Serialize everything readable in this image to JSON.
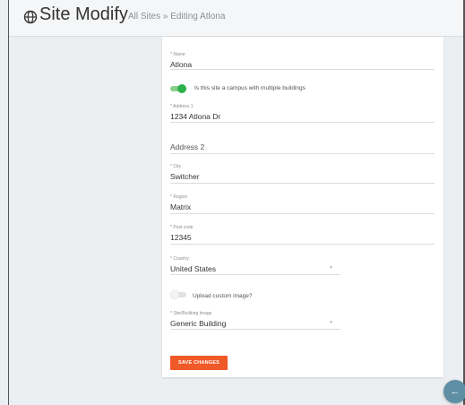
{
  "header": {
    "icon": "globe-icon",
    "title": "Site Modify",
    "breadcrumb": {
      "link": "All Sites",
      "separator": "»",
      "current": "Editing Atlona"
    }
  },
  "form": {
    "name": {
      "label": "* Name",
      "value": "Atlona"
    },
    "campus_toggle": {
      "label": "Is this site a campus with multiple buildings",
      "on": true
    },
    "address1": {
      "label": "* Address 1",
      "value": "1234 Atlona Dr"
    },
    "address2": {
      "placeholder": "Address 2"
    },
    "city": {
      "label": "* City",
      "value": "Switcher"
    },
    "region": {
      "label": "* Region",
      "value": "Matrix"
    },
    "post_code": {
      "label": "* Post code",
      "value": "12345"
    },
    "country": {
      "label": "* Country",
      "value": "United States"
    },
    "custom_image_toggle": {
      "label": "Upload custom image?",
      "on": false
    },
    "site_image": {
      "label": "* Site/Building Image",
      "value": "Generic Building"
    },
    "save_label": "SAVE CHANGES"
  },
  "fab": {
    "icon": "arrow-left-icon",
    "glyph": "←"
  },
  "colors": {
    "accent": "#f05a28",
    "toggle_on": "#2bb24c",
    "fab": "#5e8fa5"
  }
}
